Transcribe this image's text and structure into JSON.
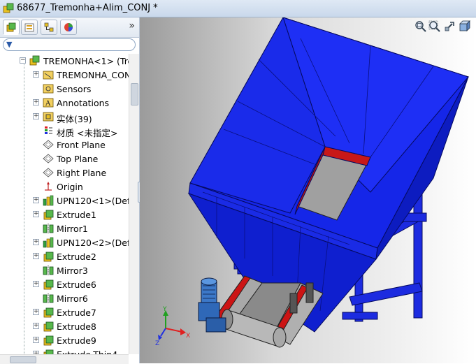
{
  "window": {
    "title": "68677_Tremonha+Alim_CONJ *"
  },
  "panel": {
    "tabs": [
      {
        "name": "featuremanager"
      },
      {
        "name": "propertymanager"
      },
      {
        "name": "configurationmanager"
      },
      {
        "name": "display-manager"
      }
    ],
    "expand_symbol": "»",
    "tree": [
      {
        "label": "TREMONHA<1> (Tre",
        "icon": "part-icon",
        "level": 0,
        "expander": "minus"
      },
      {
        "label": "TREMONHA_CON",
        "icon": "history-folder-icon",
        "level": 1,
        "expander": "plus"
      },
      {
        "label": "Sensors",
        "icon": "sensors-icon",
        "level": 1,
        "expander": ""
      },
      {
        "label": "Annotations",
        "icon": "annotations-icon",
        "level": 1,
        "expander": "plus"
      },
      {
        "label": "实体(39)",
        "icon": "solid-bodies-icon",
        "level": 1,
        "expander": "plus"
      },
      {
        "label": "材质 <未指定>",
        "icon": "material-icon",
        "level": 1,
        "expander": ""
      },
      {
        "label": "Front Plane",
        "icon": "plane-icon",
        "level": 1,
        "expander": ""
      },
      {
        "label": "Top Plane",
        "icon": "plane-icon",
        "level": 1,
        "expander": ""
      },
      {
        "label": "Right Plane",
        "icon": "plane-icon",
        "level": 1,
        "expander": ""
      },
      {
        "label": "Origin",
        "icon": "origin-icon",
        "level": 1,
        "expander": ""
      },
      {
        "label": "UPN120<1>(Defa",
        "icon": "library-feature-icon",
        "level": 1,
        "expander": "plus"
      },
      {
        "label": "Extrude1",
        "icon": "extrude-icon",
        "level": 1,
        "expander": "plus"
      },
      {
        "label": "Mirror1",
        "icon": "mirror-icon",
        "level": 1,
        "expander": ""
      },
      {
        "label": "UPN120<2>(Defa",
        "icon": "library-feature-icon",
        "level": 1,
        "expander": "plus"
      },
      {
        "label": "Extrude2",
        "icon": "extrude-icon",
        "level": 1,
        "expander": "plus"
      },
      {
        "label": "Mirror3",
        "icon": "mirror-icon",
        "level": 1,
        "expander": ""
      },
      {
        "label": "Extrude6",
        "icon": "extrude-icon",
        "level": 1,
        "expander": "plus"
      },
      {
        "label": "Mirror6",
        "icon": "mirror-icon",
        "level": 1,
        "expander": ""
      },
      {
        "label": "Extrude7",
        "icon": "extrude-icon",
        "level": 1,
        "expander": "plus"
      },
      {
        "label": "Extrude8",
        "icon": "extrude-icon",
        "level": 1,
        "expander": "plus"
      },
      {
        "label": "Extrude9",
        "icon": "extrude-icon",
        "level": 1,
        "expander": "plus"
      },
      {
        "label": "Extrude-Thin4",
        "icon": "extrude-icon",
        "level": 1,
        "expander": "plus"
      }
    ]
  },
  "viewport": {
    "toolbar": [
      {
        "name": "zoom-to-fit-icon"
      },
      {
        "name": "zoom-to-area-icon"
      },
      {
        "name": "previous-view-icon"
      },
      {
        "name": "section-view-icon"
      }
    ],
    "triad": {
      "x": "X",
      "y": "Y",
      "z": "Z"
    }
  },
  "colors": {
    "model_blue": "#1a2ae0",
    "model_red": "#cc1010",
    "axis_x": "#e02020",
    "axis_y": "#20a020",
    "axis_z": "#2030e0"
  }
}
